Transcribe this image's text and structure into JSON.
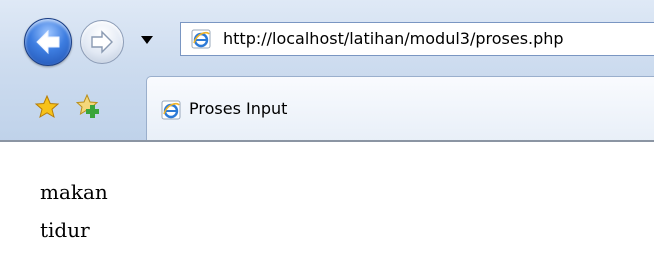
{
  "browser": {
    "address": {
      "url": "http://localhost/latihan/modul3/proses.php"
    },
    "tab": {
      "title": "Proses Input"
    },
    "icons": {
      "back": "back-arrow-icon",
      "forward": "forward-arrow-icon",
      "history": "chevron-down-icon",
      "favorites": "star-icon",
      "add_favorites": "add-favorite-icon",
      "page": "ie-page-icon"
    },
    "colors": {
      "back_button": "#3d7de0",
      "chrome": "#cddcef"
    }
  },
  "page": {
    "lines": [
      "makan",
      "tidur"
    ]
  }
}
